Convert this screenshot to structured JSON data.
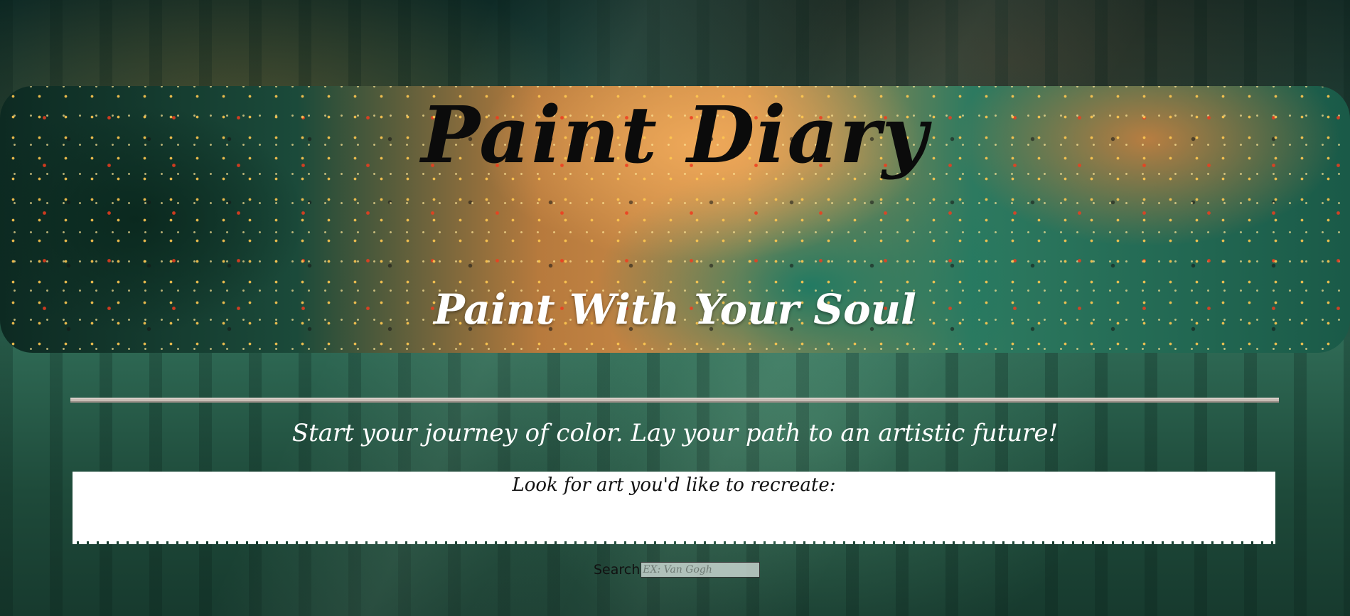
{
  "header": {
    "title": "Paint Diary",
    "tagline": "Paint With Your Soul"
  },
  "main": {
    "intro": "Start your journey of color. Lay your path to an artistic future!",
    "search_prompt": "Look for art you'd like to recreate:",
    "search": {
      "label": "Search",
      "placeholder": "EX: Van Gogh",
      "value": ""
    }
  },
  "colors": {
    "title_text": "#0b0b0b",
    "tagline_text": "#ffffff",
    "panel_bg": "#ffffff"
  }
}
